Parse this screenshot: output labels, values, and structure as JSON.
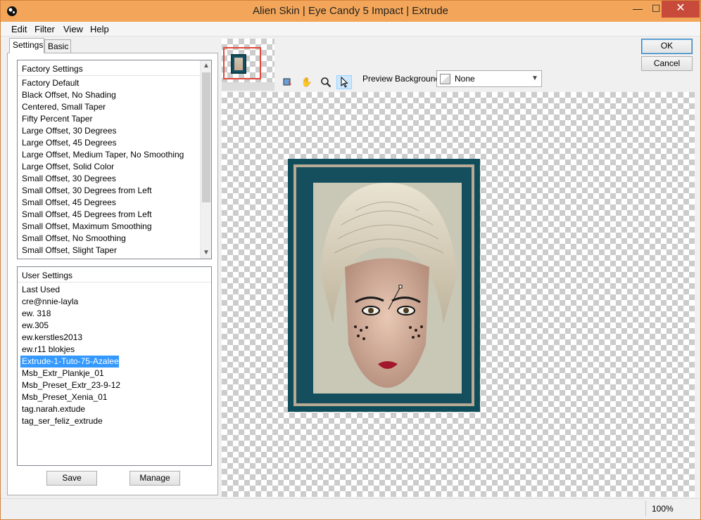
{
  "window": {
    "title": "Alien Skin | Eye Candy 5 Impact | Extrude",
    "controls": {
      "minimize": "—",
      "maximize": "☐",
      "close": "✕"
    }
  },
  "menu": [
    "Edit",
    "Filter",
    "View",
    "Help"
  ],
  "tabs": [
    "Settings",
    "Basic"
  ],
  "factory": {
    "header": "Factory Settings",
    "items": [
      "Factory Default",
      "Black Offset, No Shading",
      "Centered, Small Taper",
      "Fifty Percent Taper",
      "Large Offset, 30 Degrees",
      "Large Offset, 45 Degrees",
      "Large Offset, Medium Taper, No Smoothing",
      "Large Offset, Solid Color",
      "Small Offset, 30 Degrees",
      "Small Offset, 30 Degrees from Left",
      "Small Offset, 45 Degrees",
      "Small Offset, 45 Degrees from Left",
      "Small Offset, Maximum Smoothing",
      "Small Offset, No Smoothing",
      "Small Offset, Slight Taper"
    ]
  },
  "user": {
    "header": "User Settings",
    "items": [
      "Last Used",
      "cre@nnie-layla",
      "ew. 318",
      "ew.305",
      "ew.kerstles2013",
      "ew.r11 blokjes",
      "Extrude-1-Tuto-75-Azalee",
      "Msb_Extr_Plankje_01",
      "Msb_Preset_Extr_23-9-12",
      "Msb_Preset_Xenia_01",
      "tag.narah.extude",
      "tag_ser_feliz_extrude"
    ],
    "selected_index": 6
  },
  "buttons": {
    "save": "Save",
    "manage": "Manage",
    "ok": "OK",
    "cancel": "Cancel"
  },
  "tools": [
    "preview-hand-icon",
    "hand-icon",
    "zoom-icon",
    "arrow-icon"
  ],
  "preview_background": {
    "label": "Preview Background:",
    "value": "None"
  },
  "status": {
    "zoom": "100%"
  },
  "colors": {
    "frame": "#0f4d5b",
    "frame_mat": "#b9aa95",
    "title_bar": "#f3a659",
    "selection": "#3399ff"
  }
}
